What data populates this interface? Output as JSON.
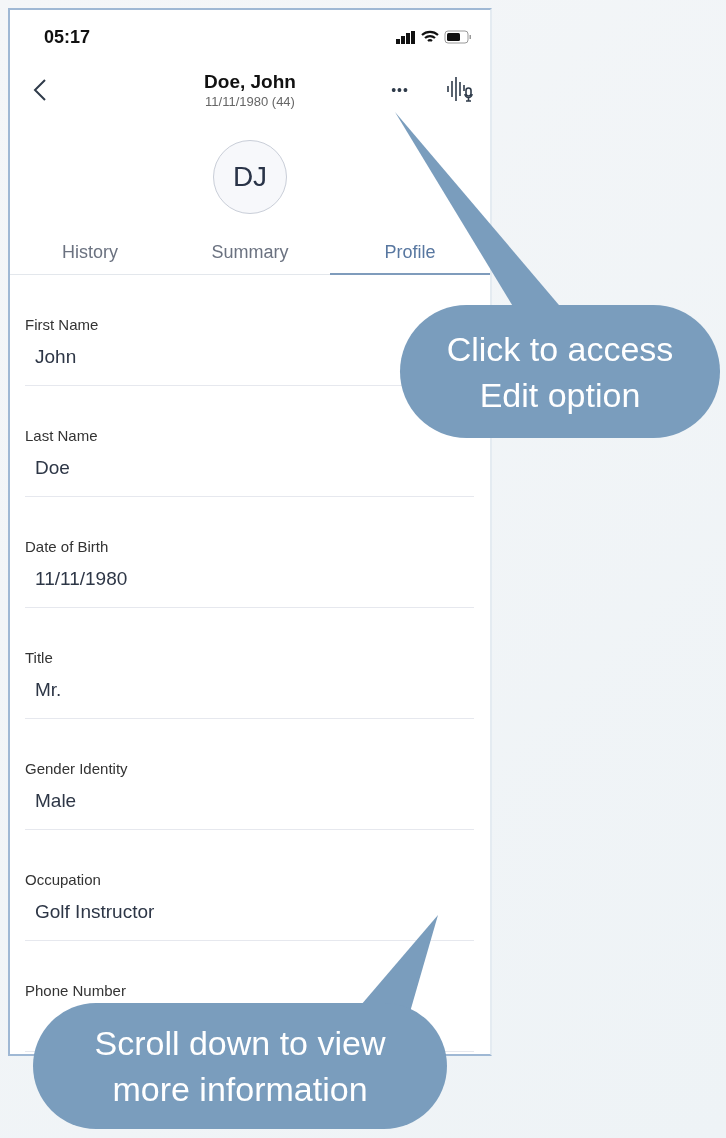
{
  "status_bar": {
    "time": "05:17"
  },
  "header": {
    "name": "Doe, John",
    "subtitle": "11/11/1980 (44)",
    "more": "•••",
    "avatar": "DJ"
  },
  "tabs": [
    {
      "label": "History",
      "selected": false
    },
    {
      "label": "Summary",
      "selected": false
    },
    {
      "label": "Profile",
      "selected": true
    }
  ],
  "fields": [
    {
      "label": "First Name",
      "value": "John"
    },
    {
      "label": "Last Name",
      "value": "Doe"
    },
    {
      "label": "Date of Birth",
      "value": "11/11/1980"
    },
    {
      "label": "Title",
      "value": "Mr."
    },
    {
      "label": "Gender Identity",
      "value": "Male"
    },
    {
      "label": "Occupation",
      "value": "Golf Instructor"
    },
    {
      "label": "Phone Number"
    }
  ],
  "callouts": [
    {
      "text": "Click to access Edit option"
    },
    {
      "text": "Scroll down to view more information"
    }
  ]
}
